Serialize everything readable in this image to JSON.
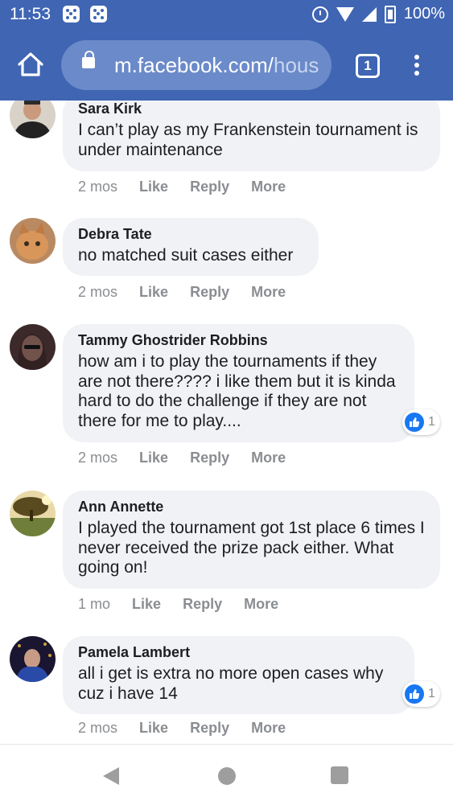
{
  "status_bar": {
    "time": "11:53",
    "battery": "100%"
  },
  "browser": {
    "url_main": "m.facebook.com/",
    "url_rest": "hous",
    "tab_count": "1"
  },
  "comments": [
    {
      "author": "Sara Kirk",
      "text": "I can’t play as my Frankenstein tournament is under maintenance",
      "time": "2 mos",
      "reactions": null
    },
    {
      "author": "Debra Tate",
      "text": "no matched suit cases either",
      "time": "2 mos",
      "reactions": null
    },
    {
      "author": "Tammy Ghostrider Robbins",
      "text": "how am i to play the tournaments if they are not there???? i like them but it is kinda hard to do the challenge if they are not there for me to play....",
      "time": "2 mos",
      "reactions": "1"
    },
    {
      "author": "Ann Annette",
      "text": "I played the tournament got 1st place 6 times I never received the prize pack either. What going on!",
      "time": "1 mo",
      "reactions": null
    },
    {
      "author": "Pamela Lambert",
      "text": "all i get is extra no more open cases why cuz i have 14",
      "time": "2 mos",
      "reactions": "1"
    }
  ],
  "actions": {
    "like": "Like",
    "reply": "Reply",
    "more": "More"
  },
  "colors": {
    "brand": "#3f65b3",
    "like_blue": "#1877f2",
    "bubble": "#f0f2f5"
  }
}
